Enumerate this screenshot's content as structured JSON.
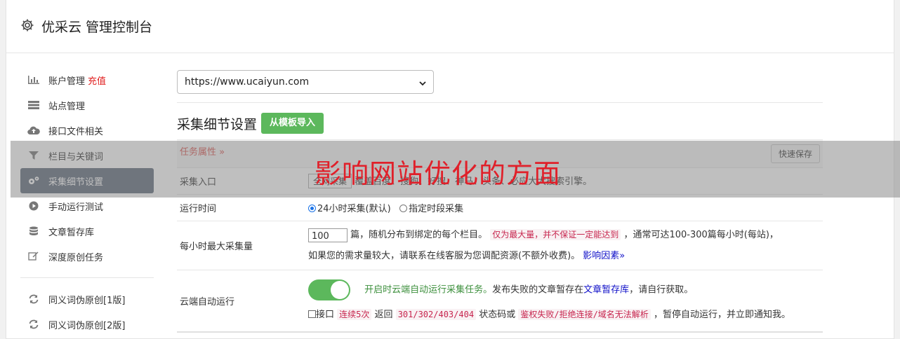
{
  "header": {
    "title": "优采云 管理控制台",
    "icon": "gear-icon"
  },
  "sidebar": {
    "items": [
      {
        "label": "账户管理",
        "badge": "充值",
        "icon": "bar-chart-icon"
      },
      {
        "label": "站点管理",
        "icon": "server-icon"
      },
      {
        "label": "接口文件相关",
        "icon": "cloud-upload-icon"
      },
      {
        "label": "栏目与关键词",
        "icon": "filter-icon"
      },
      {
        "label": "采集细节设置",
        "icon": "gears-icon",
        "active": true
      },
      {
        "label": "手动运行测试",
        "icon": "play-circle-icon"
      },
      {
        "label": "文章暂存库",
        "icon": "database-icon"
      },
      {
        "label": "深度原创任务",
        "icon": "edit-icon"
      },
      {
        "label": "同义词伪原创[1版]",
        "icon": "refresh-icon"
      },
      {
        "label": "同义词伪原创[2版]",
        "icon": "refresh-icon"
      }
    ]
  },
  "site_select": {
    "value": "https://www.ucaiyun.com"
  },
  "section": {
    "title": "采集细节设置",
    "import_button": "从模板导入"
  },
  "table": {
    "head": {
      "label": "任务属性 »",
      "save_button": "快速保存"
    },
    "row1": {
      "label": "采集入口",
      "button": "全网采集",
      "text": "覆盖百度、搜狗、好搜、神马、头条、必应大大搜索引擎。"
    },
    "row2": {
      "label": "运行时间",
      "option1": "24小时采集(默认)",
      "option2": "指定时段采集"
    },
    "row3": {
      "label": "每小时最大采集量",
      "value": "100",
      "text1": "篇，随机分布到绑定的每个栏目。",
      "code": "仅为最大量，并不保证一定能达到",
      "text2": "，通常可达100-300篇每小时(每站)，",
      "text3": "如果您的需求量较大，请联系在线客服为您调配资源(不额外收费)。",
      "link": "影响因素»"
    },
    "row4": {
      "label": "云端自动运行",
      "green_text": "开启时云端自动运行采集任务。",
      "text1": "发布失败的文章暂存在",
      "link": "文章暂存库",
      "text2": "，请自行获取。",
      "chk_label": "接口",
      "code1": "连续5次",
      "text3": "返回",
      "code2": "301/302/403/404",
      "text4": "状态码或",
      "code3": "鉴权失败/拒绝连接/域名无法解析",
      "text5": "，暂停自动运行，并立即通知我。"
    }
  },
  "watermark": "影响网站优化的方面"
}
